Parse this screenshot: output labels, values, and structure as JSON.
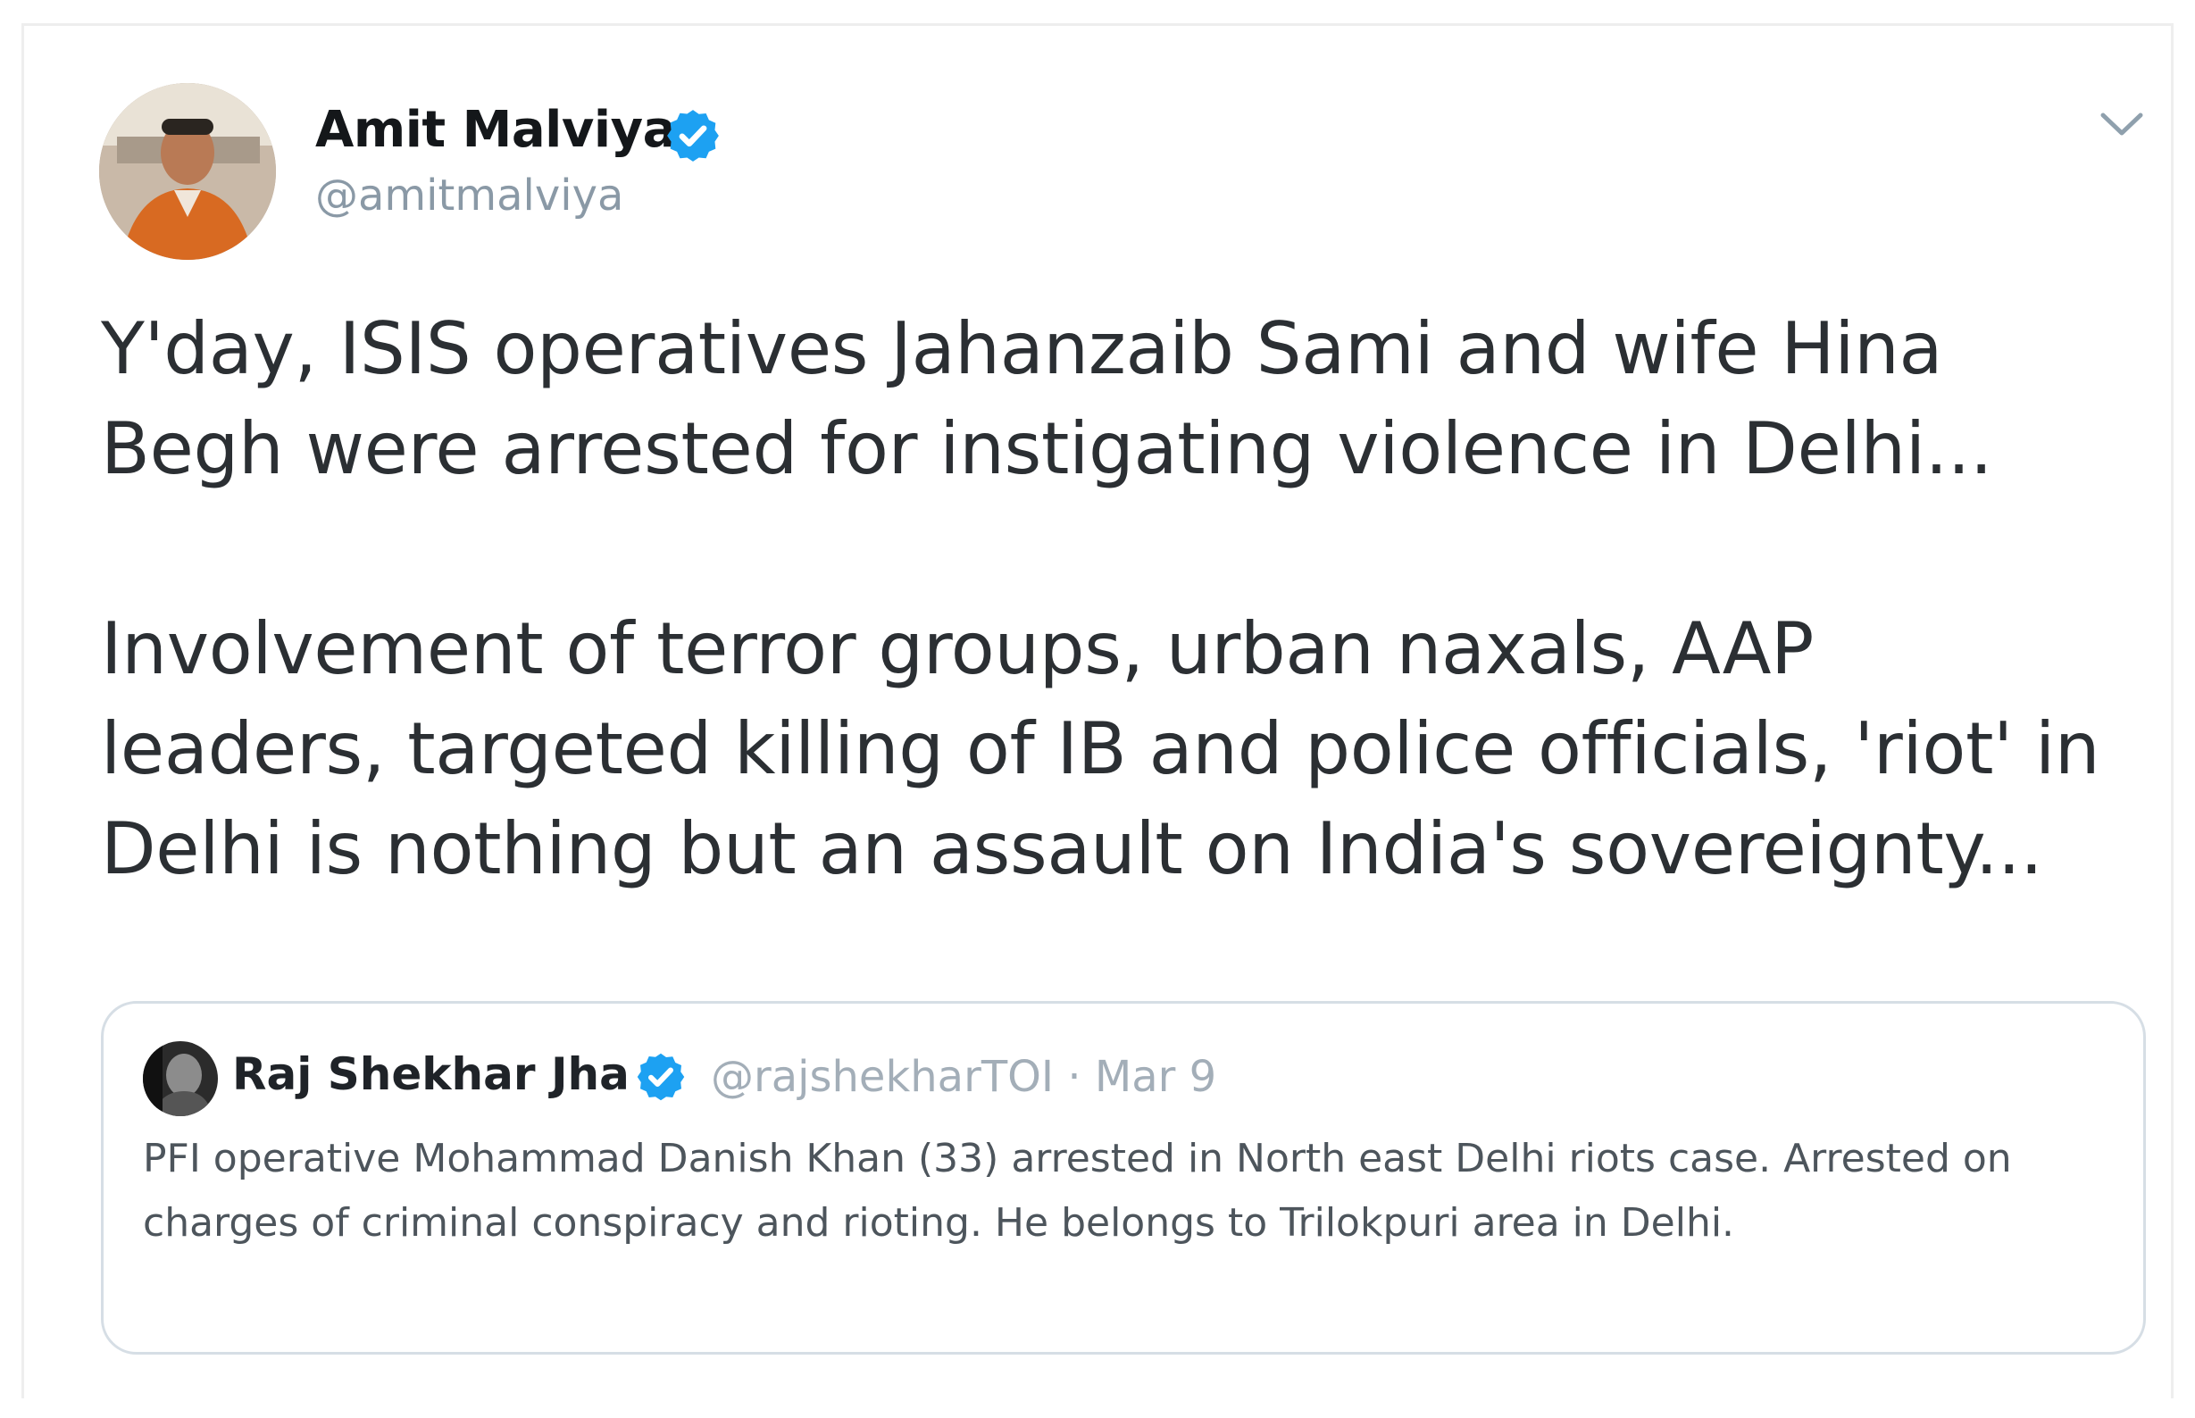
{
  "tweet": {
    "author": {
      "name": "Amit Malviya",
      "handle": "@amitmalviya",
      "verified": true
    },
    "paragraphs": [
      "Y'day, ISIS operatives Jahanzaib Sami and wife Hina\nBegh were arrested for instigating violence in Delhi...",
      "Involvement of terror groups, urban naxals, AAP\nleaders, targeted killing of IB and police officials, 'riot' in\nDelhi is nothing but an assault on India's sovereignty..."
    ],
    "quoted_tweet": {
      "author_name": "Raj Shekhar Jha",
      "handle_and_date": "@rajshekharTOI · Mar 9",
      "verified": true,
      "text": "PFI operative Mohammad Danish Khan (33) arrested in North east Delhi riots case. Arrested on charges of criminal conspiracy and rioting. He belongs to Trilokpuri area in Delhi."
    }
  },
  "colors": {
    "verified_blue": "#1da1f2",
    "text_dark": "#14171a",
    "text_muted": "#8a99a6",
    "border": "#d6dee5"
  },
  "icons": {
    "verified": "verified-badge-icon",
    "caret": "chevron-down-icon"
  }
}
